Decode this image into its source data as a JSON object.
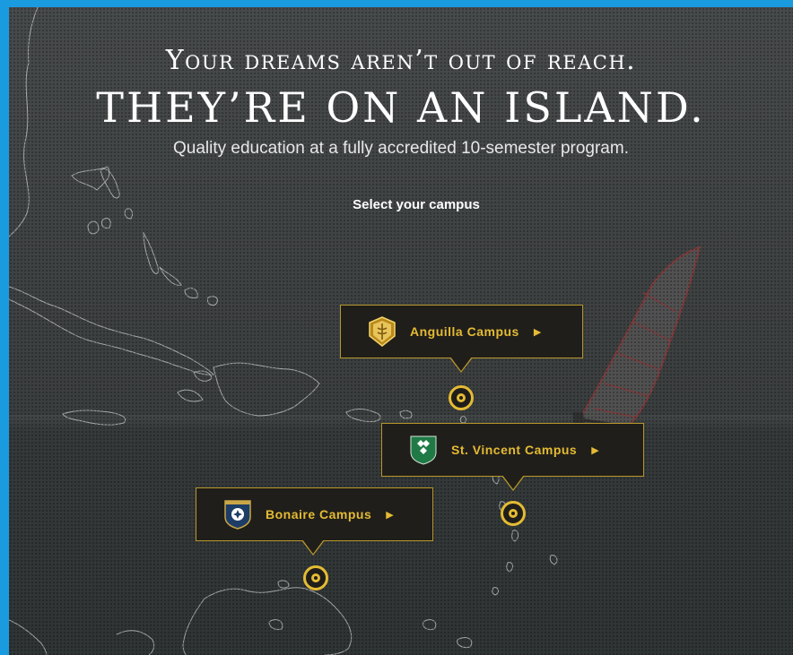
{
  "headline": {
    "line1": "Your dreams aren’t out of reach.",
    "line2": "They’re on an island.",
    "subtitle": "Quality education at a fully accredited 10-semester program."
  },
  "prompt": "Select your campus",
  "campuses": [
    {
      "label": "Anguilla Campus",
      "arrow": "▶",
      "icon": "anguilla-crest-icon"
    },
    {
      "label": "St. Vincent Campus",
      "arrow": "▶",
      "icon": "st-vincent-crest-icon"
    },
    {
      "label": "Bonaire Campus",
      "arrow": "▶",
      "icon": "bonaire-crest-icon"
    }
  ],
  "colors": {
    "accent": "#e4bb34",
    "button_bg": "#201e1a",
    "frame_border": "#1a9be0"
  }
}
